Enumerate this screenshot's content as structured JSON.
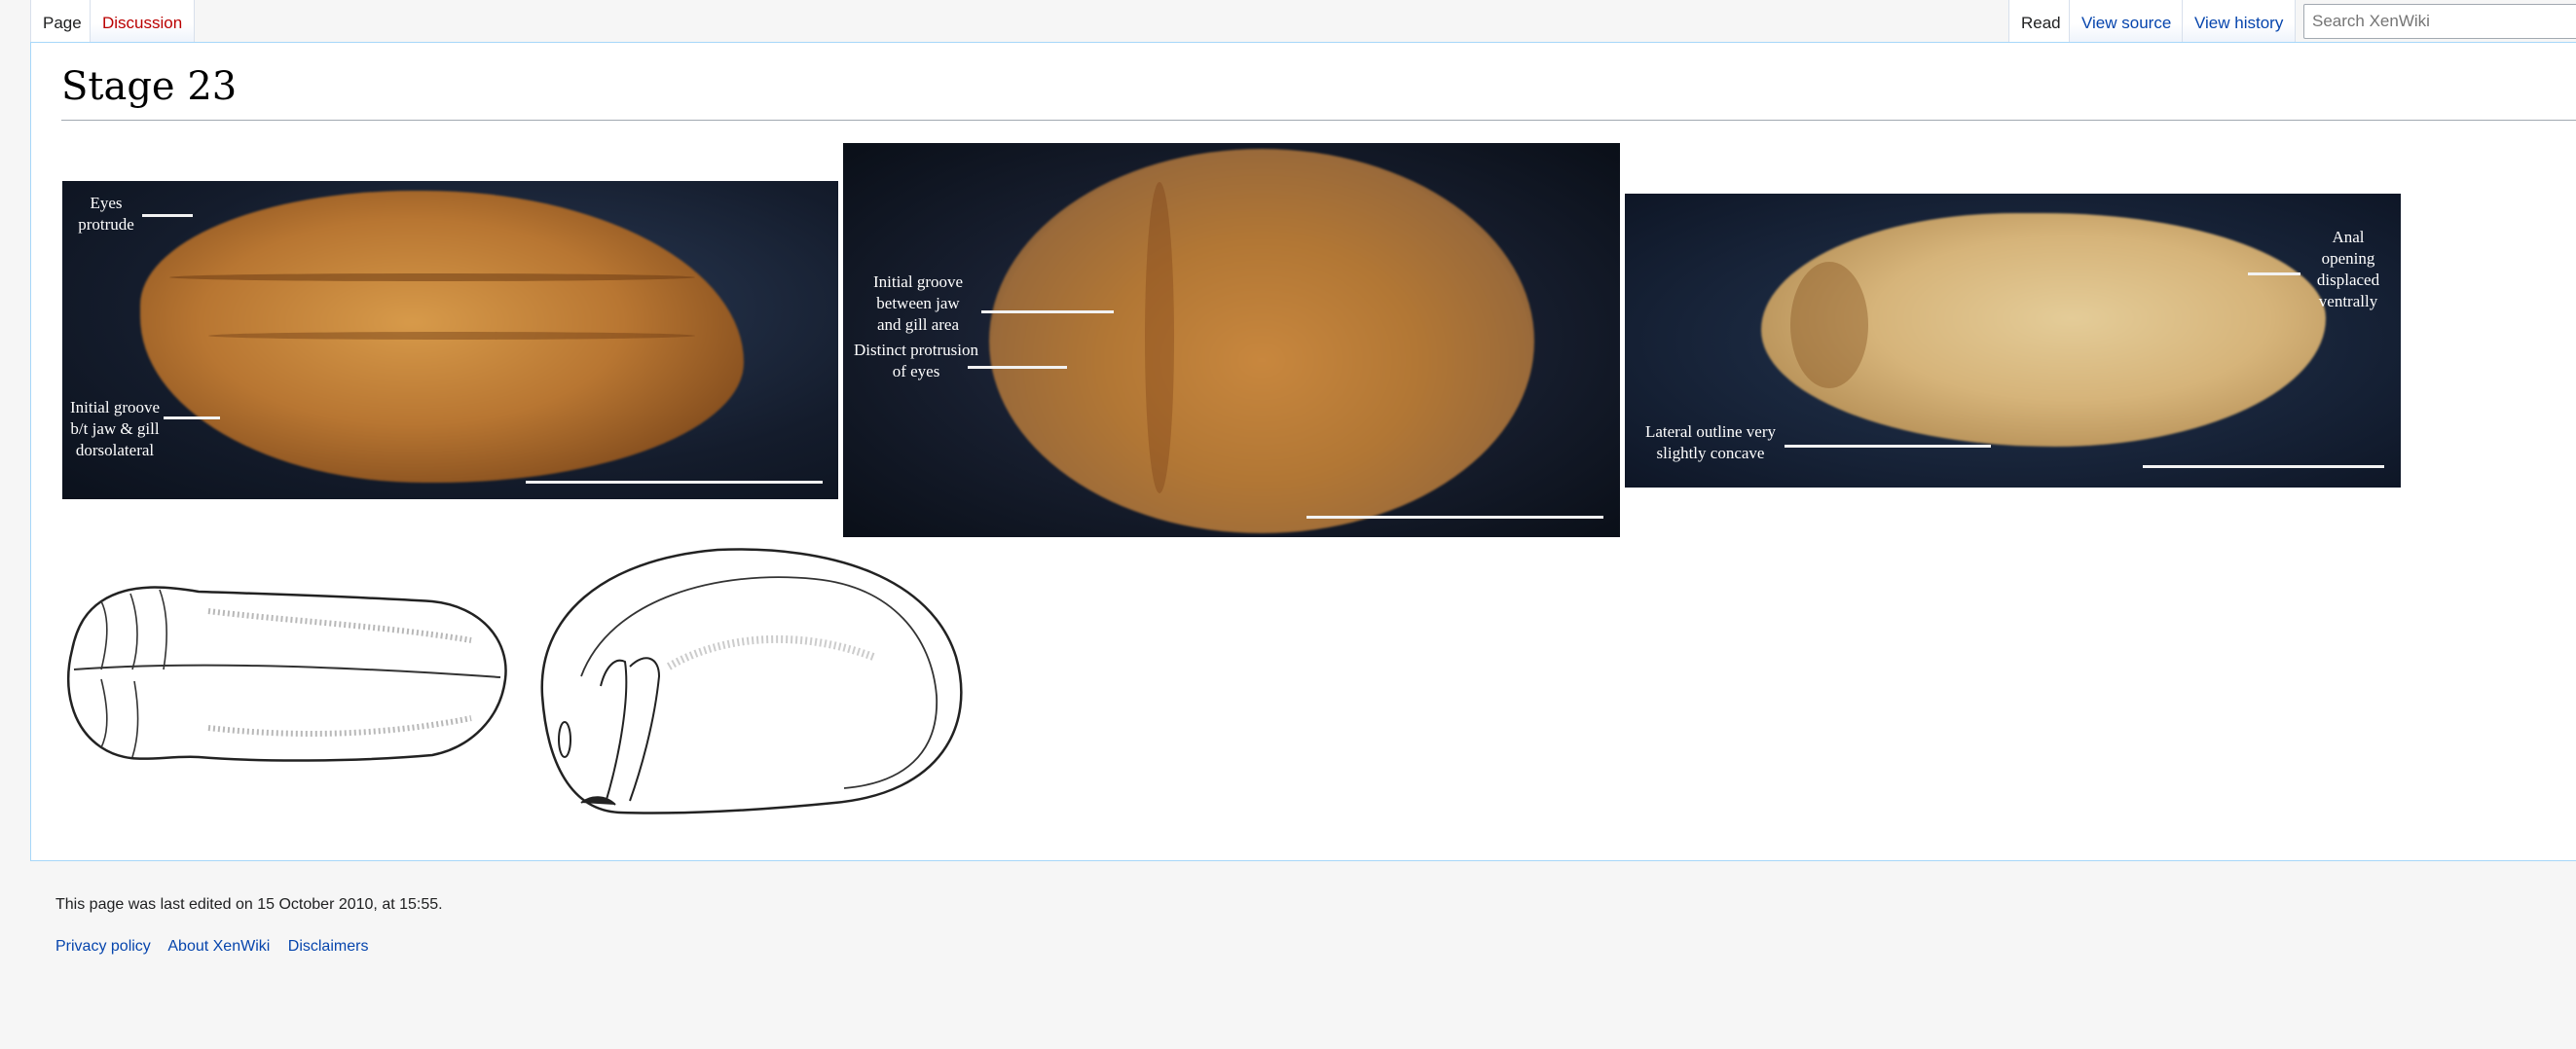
{
  "tabs": {
    "page": "Page",
    "discussion": "Discussion",
    "read": "Read",
    "view_source": "View source",
    "view_history": "View history"
  },
  "search": {
    "placeholder": "Search XenWiki"
  },
  "page_title": "Stage 23",
  "photos": [
    {
      "labels": {
        "eyes": "Eyes\nprotrude",
        "groove": "Initial groove\nb/t  jaw & gill\ndorsolateral"
      }
    },
    {
      "labels": {
        "groove": "Initial groove\nbetween jaw\nand gill area",
        "eyes": "Distinct protrusion\nof eyes"
      }
    },
    {
      "labels": {
        "anal": "Anal\nopening\ndisplaced\nventrally",
        "lateral": "Lateral outline very\nslightly concave"
      }
    }
  ],
  "footer": {
    "last_edited": "This page was last edited on 15 October 2010, at 15:55.",
    "links": [
      "Privacy policy",
      "About XenWiki",
      "Disclaimers"
    ]
  },
  "colors": {
    "link": "#0645ad",
    "new_link": "#ba0000",
    "border": "#a7d7f9",
    "embryo": "#c98a3c"
  }
}
